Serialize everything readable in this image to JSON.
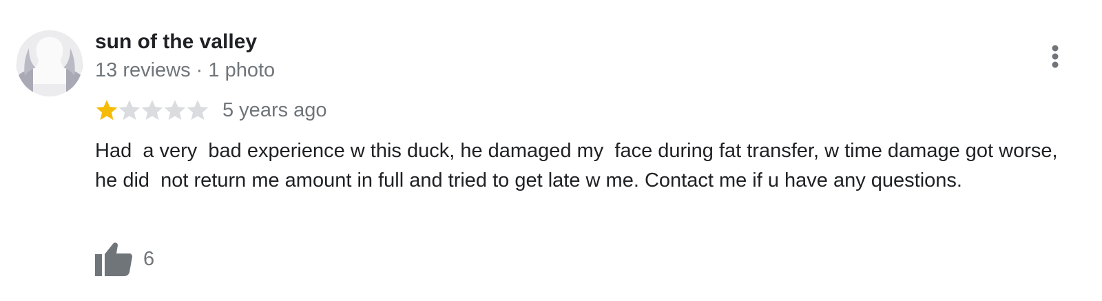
{
  "review": {
    "author_name": "sun of the valley",
    "author_meta": "13 reviews · 1 photo",
    "rating": 1,
    "rating_max": 5,
    "date": "5 years ago",
    "text": "Had  a very  bad experience w this duck, he damaged my  face during fat transfer, w time damage got worse, he did  not return me amount in full and tried to get late w me. Contact me if u have any questions.",
    "like_count": "6"
  },
  "icons": {
    "avatar": "default-profile-icon",
    "more": "more-vert-icon",
    "like": "thumb-up-icon",
    "star_filled": "star-filled-icon",
    "star_empty": "star-empty-icon"
  },
  "colors": {
    "star_filled": "#f6bb06",
    "star_empty": "#dadce0",
    "secondary_text": "#70757a",
    "icon_gray": "#70757a"
  }
}
